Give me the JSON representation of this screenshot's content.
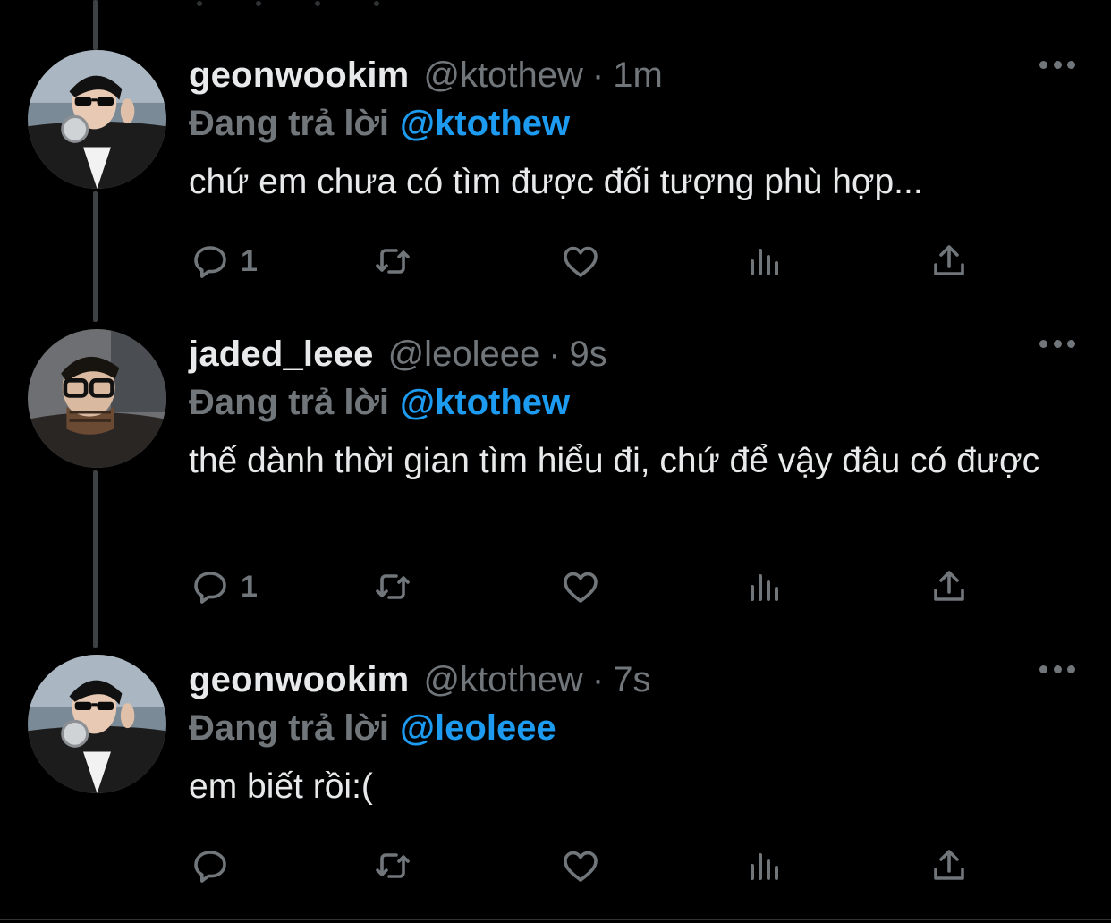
{
  "colors": {
    "background": "#000000",
    "text_primary": "#e7e9ea",
    "text_secondary": "#71767b",
    "accent": "#1d9bf0",
    "thread_line": "#3e4144"
  },
  "tweets": [
    {
      "display_name": "geonwookim",
      "handle": "@ktothew",
      "separator": "·",
      "time": "1m",
      "reply_label": "Đang trả lời",
      "reply_to": "@ktothew",
      "text": "chứ em chưa có tìm được đối tượng phù hợp...",
      "reply_count": "1",
      "avatar_icon": "user-avatar-photo-sunglasses"
    },
    {
      "display_name": "jaded_leee",
      "handle": "@leoleee",
      "separator": "·",
      "time": "9s",
      "reply_label": "Đang trả lời",
      "reply_to": "@ktothew",
      "text": "thế dành thời gian tìm hiểu đi, chứ để vậy đâu có được",
      "reply_count": "1",
      "avatar_icon": "user-avatar-photo-glasses"
    },
    {
      "display_name": "geonwookim",
      "handle": "@ktothew",
      "separator": "·",
      "time": "7s",
      "reply_label": "Đang trả lời",
      "reply_to": "@leoleee",
      "text": "em biết rồi:(",
      "reply_count": "",
      "avatar_icon": "user-avatar-photo-sunglasses"
    }
  ],
  "action_icons": [
    "reply-icon",
    "retweet-icon",
    "like-icon",
    "views-icon",
    "share-icon"
  ]
}
